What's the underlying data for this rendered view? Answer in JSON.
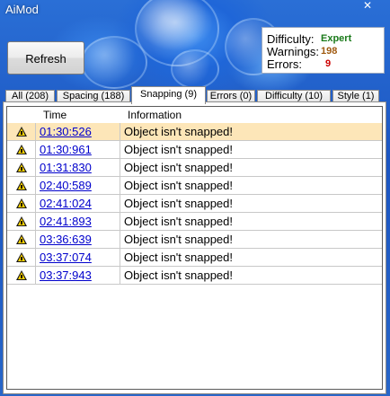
{
  "window": {
    "title": "AiMod",
    "close_label": "✕"
  },
  "toolbar": {
    "refresh_label": "Refresh"
  },
  "stats": {
    "difficulty_label": "Difficulty:",
    "difficulty_value": "Expert",
    "warnings_label": "Warnings:",
    "warnings_value": "198",
    "errors_label": "Errors:",
    "errors_value": "9",
    "colors": {
      "difficulty": "#1a7a1a",
      "warnings": "#a05a10",
      "errors": "#cc0000"
    }
  },
  "tabs": [
    {
      "label": "All (208)"
    },
    {
      "label": "Spacing (188)"
    },
    {
      "label": "Snapping (9)",
      "active": true
    },
    {
      "label": "Errors (0)"
    },
    {
      "label": "Difficulty (10)"
    },
    {
      "label": "Style (1)"
    }
  ],
  "grid": {
    "columns": [
      "",
      "Time",
      "Information"
    ],
    "rows": [
      {
        "time": "01:30:526",
        "info": "Object isn't snapped!",
        "icon": "warning-icon",
        "selected": true
      },
      {
        "time": "01:30:961",
        "info": "Object isn't snapped!",
        "icon": "warning-icon"
      },
      {
        "time": "01:31:830",
        "info": "Object isn't snapped!",
        "icon": "warning-icon"
      },
      {
        "time": "02:40:589",
        "info": "Object isn't snapped!",
        "icon": "warning-icon"
      },
      {
        "time": "02:41:024",
        "info": "Object isn't snapped!",
        "icon": "warning-icon"
      },
      {
        "time": "02:41:893",
        "info": "Object isn't snapped!",
        "icon": "warning-icon"
      },
      {
        "time": "03:36:639",
        "info": "Object isn't snapped!",
        "icon": "warning-icon"
      },
      {
        "time": "03:37:074",
        "info": "Object isn't snapped!",
        "icon": "warning-icon"
      },
      {
        "time": "03:37:943",
        "info": "Object isn't snapped!",
        "icon": "warning-icon"
      }
    ],
    "selected_row_color": "#fde6b8",
    "link_color": "#0000cc"
  }
}
